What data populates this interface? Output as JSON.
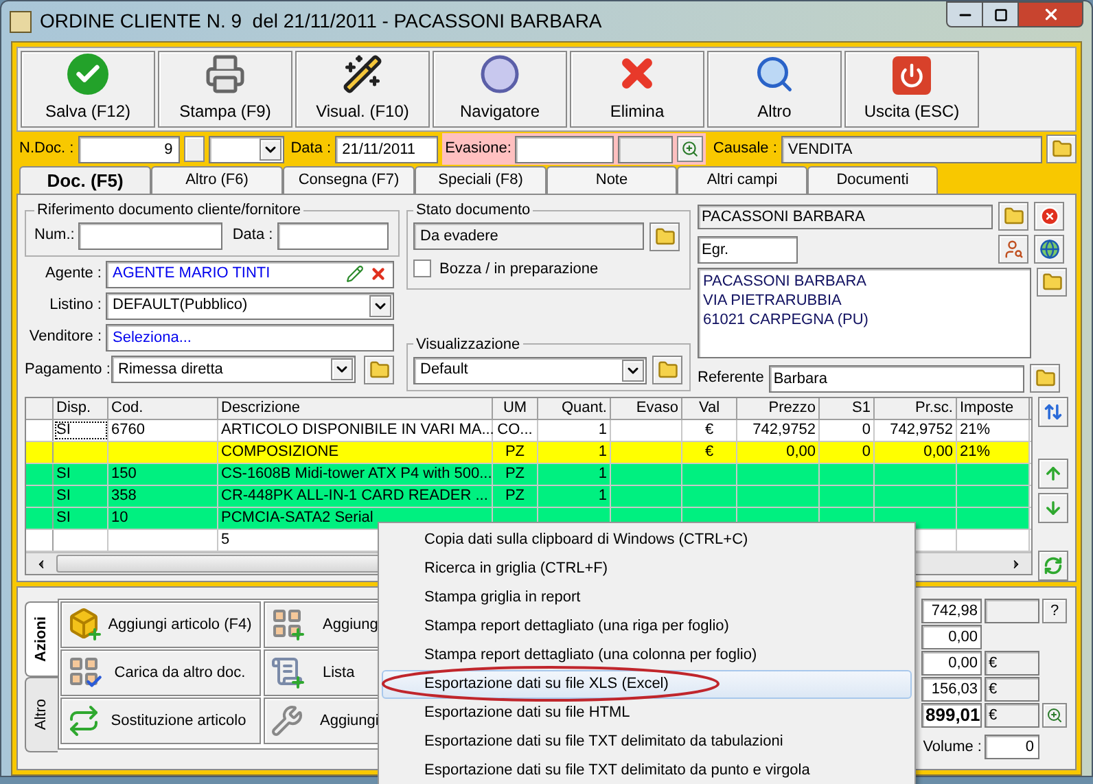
{
  "window": {
    "title": "ORDINE CLIENTE N. 9  del 21/11/2011 - PACASSONI BARBARA"
  },
  "toolbar": [
    {
      "kind": "save",
      "label": "Salva (F12)"
    },
    {
      "kind": "print",
      "label": "Stampa (F9)"
    },
    {
      "kind": "view",
      "label": "Visual. (F10)"
    },
    {
      "kind": "navigator",
      "label": "Navigatore"
    },
    {
      "kind": "delete",
      "label": "Elimina"
    },
    {
      "kind": "more",
      "label": "Altro"
    },
    {
      "kind": "exit",
      "label": "Uscita (ESC)"
    }
  ],
  "header": {
    "ndoc_label": "N.Doc. :",
    "ndoc": "9",
    "data_label": "Data :",
    "data": "21/11/2011",
    "evasione_label": "Evasione:",
    "causale_label": "Causale :",
    "causale": "VENDITA"
  },
  "tabs": [
    {
      "label": "Doc. (F5)",
      "selected": true
    },
    {
      "label": "Altro (F6)",
      "selected": false
    },
    {
      "label": "Consegna (F7)",
      "selected": false
    },
    {
      "label": "Speciali (F8)",
      "selected": false
    },
    {
      "label": "Note",
      "selected": false
    },
    {
      "label": "Altri campi",
      "selected": false
    },
    {
      "label": "Documenti",
      "selected": false
    }
  ],
  "reference_group": {
    "title": "Riferimento documento cliente/fornitore",
    "num_label": "Num.:",
    "data_label": "Data :"
  },
  "agent": {
    "label": "Agente :",
    "value": "AGENTE MARIO TINTI"
  },
  "price_list": {
    "label": "Listino :",
    "value": "DEFAULT(Pubblico)"
  },
  "seller": {
    "label": "Venditore :",
    "value": "Seleziona..."
  },
  "payment": {
    "label": "Pagamento :",
    "value": "Rimessa diretta"
  },
  "status_group": {
    "title": "Stato documento",
    "value": "Da evadere",
    "draft_label": "Bozza / in preparazione",
    "draft_checked": false
  },
  "view_group": {
    "title": "Visualizzazione",
    "value": "Default"
  },
  "customer": {
    "name": "PACASSONI BARBARA",
    "salutation": "Egr.",
    "address": [
      "PACASSONI BARBARA",
      "VIA PIETRARUBBIA",
      "61021 CARPEGNA (PU)"
    ],
    "contact_label": "Referente",
    "contact": "Barbara"
  },
  "grid": {
    "columns": [
      "Disp.",
      "Cod.",
      "Descrizione",
      "UM",
      "Quant.",
      "Evaso",
      "Val",
      "Prezzo",
      "S1",
      "Pr.sc.",
      "Imposte"
    ],
    "rows": [
      {
        "color": "#ffffff",
        "focused": true,
        "cells": [
          "SI",
          "6760",
          "ARTICOLO DISPONIBILE IN VARI MA...",
          "CO...",
          "1",
          null,
          "€",
          "742,9752",
          "0",
          "742,9752",
          "21%"
        ]
      },
      {
        "color": "#ffff00",
        "focused": false,
        "cells": [
          null,
          null,
          "COMPOSIZIONE",
          "PZ",
          "1",
          null,
          "€",
          "0,00",
          "0",
          "0,00",
          "21%"
        ]
      },
      {
        "color": "#00f080",
        "focused": false,
        "cells": [
          "SI",
          "150",
          "CS-1608B Midi-tower ATX P4 with 500...",
          "PZ",
          "1",
          null,
          null,
          null,
          null,
          null,
          null
        ]
      },
      {
        "color": "#00f080",
        "focused": false,
        "cells": [
          "SI",
          "358",
          "CR-448PK ALL-IN-1 CARD READER ...",
          "PZ",
          "1",
          null,
          null,
          null,
          null,
          null,
          null
        ]
      },
      {
        "color": "#00f080",
        "focused": false,
        "cells": [
          "SI",
          "10",
          "PCMCIA-SATA2 Serial",
          null,
          null,
          null,
          null,
          null,
          null,
          null,
          null
        ]
      },
      {
        "color": "#ffffff",
        "focused": false,
        "cells": [
          null,
          null,
          "5",
          null,
          null,
          null,
          null,
          null,
          null,
          null,
          null
        ]
      }
    ]
  },
  "action_tabs": [
    {
      "label": "Azioni",
      "selected": true
    },
    {
      "label": "Altro",
      "selected": false
    }
  ],
  "actions": [
    [
      {
        "kind": "add-item",
        "label": "Aggiungi articolo (F4)"
      },
      {
        "kind": "add-grid",
        "label": "Aggiung"
      }
    ],
    [
      {
        "kind": "load-doc",
        "label": "Carica da altro doc."
      },
      {
        "kind": "list",
        "label": "Lista"
      }
    ],
    [
      {
        "kind": "replace",
        "label": "Sostituzione articolo"
      },
      {
        "kind": "tool",
        "label": "Aggiungi"
      }
    ]
  ],
  "totals": [
    {
      "kind": "help",
      "value": "742,98",
      "button": "?"
    },
    {
      "kind": "plain",
      "value": "0,00"
    },
    {
      "kind": "currency",
      "value": "0,00",
      "currency": "€"
    },
    {
      "kind": "currency",
      "value": "156,03",
      "currency": "€"
    },
    {
      "kind": "total",
      "value": "899,01",
      "currency": "€"
    }
  ],
  "volume": {
    "label": "Volume :",
    "value": "0"
  },
  "context_menu": {
    "items": [
      {
        "label": "Copia dati sulla clipboard di Windows (CTRL+C)",
        "selected": false
      },
      {
        "label": "Ricerca in griglia (CTRL+F)",
        "selected": false
      },
      {
        "label": "Stampa griglia in report",
        "selected": false
      },
      {
        "label": "Stampa report dettagliato (una riga per foglio)",
        "selected": false
      },
      {
        "label": "Stampa report dettagliato (una colonna per foglio)",
        "selected": false
      },
      {
        "label": "Esportazione dati su file XLS (Excel)",
        "selected": true
      },
      {
        "label": "Esportazione dati su file HTML",
        "selected": false
      },
      {
        "label": "Esportazione dati su file TXT delimitato da tabulazioni",
        "selected": false
      },
      {
        "label": "Esportazione dati su file TXT delimitato da punto e virgola",
        "selected": false
      }
    ]
  }
}
